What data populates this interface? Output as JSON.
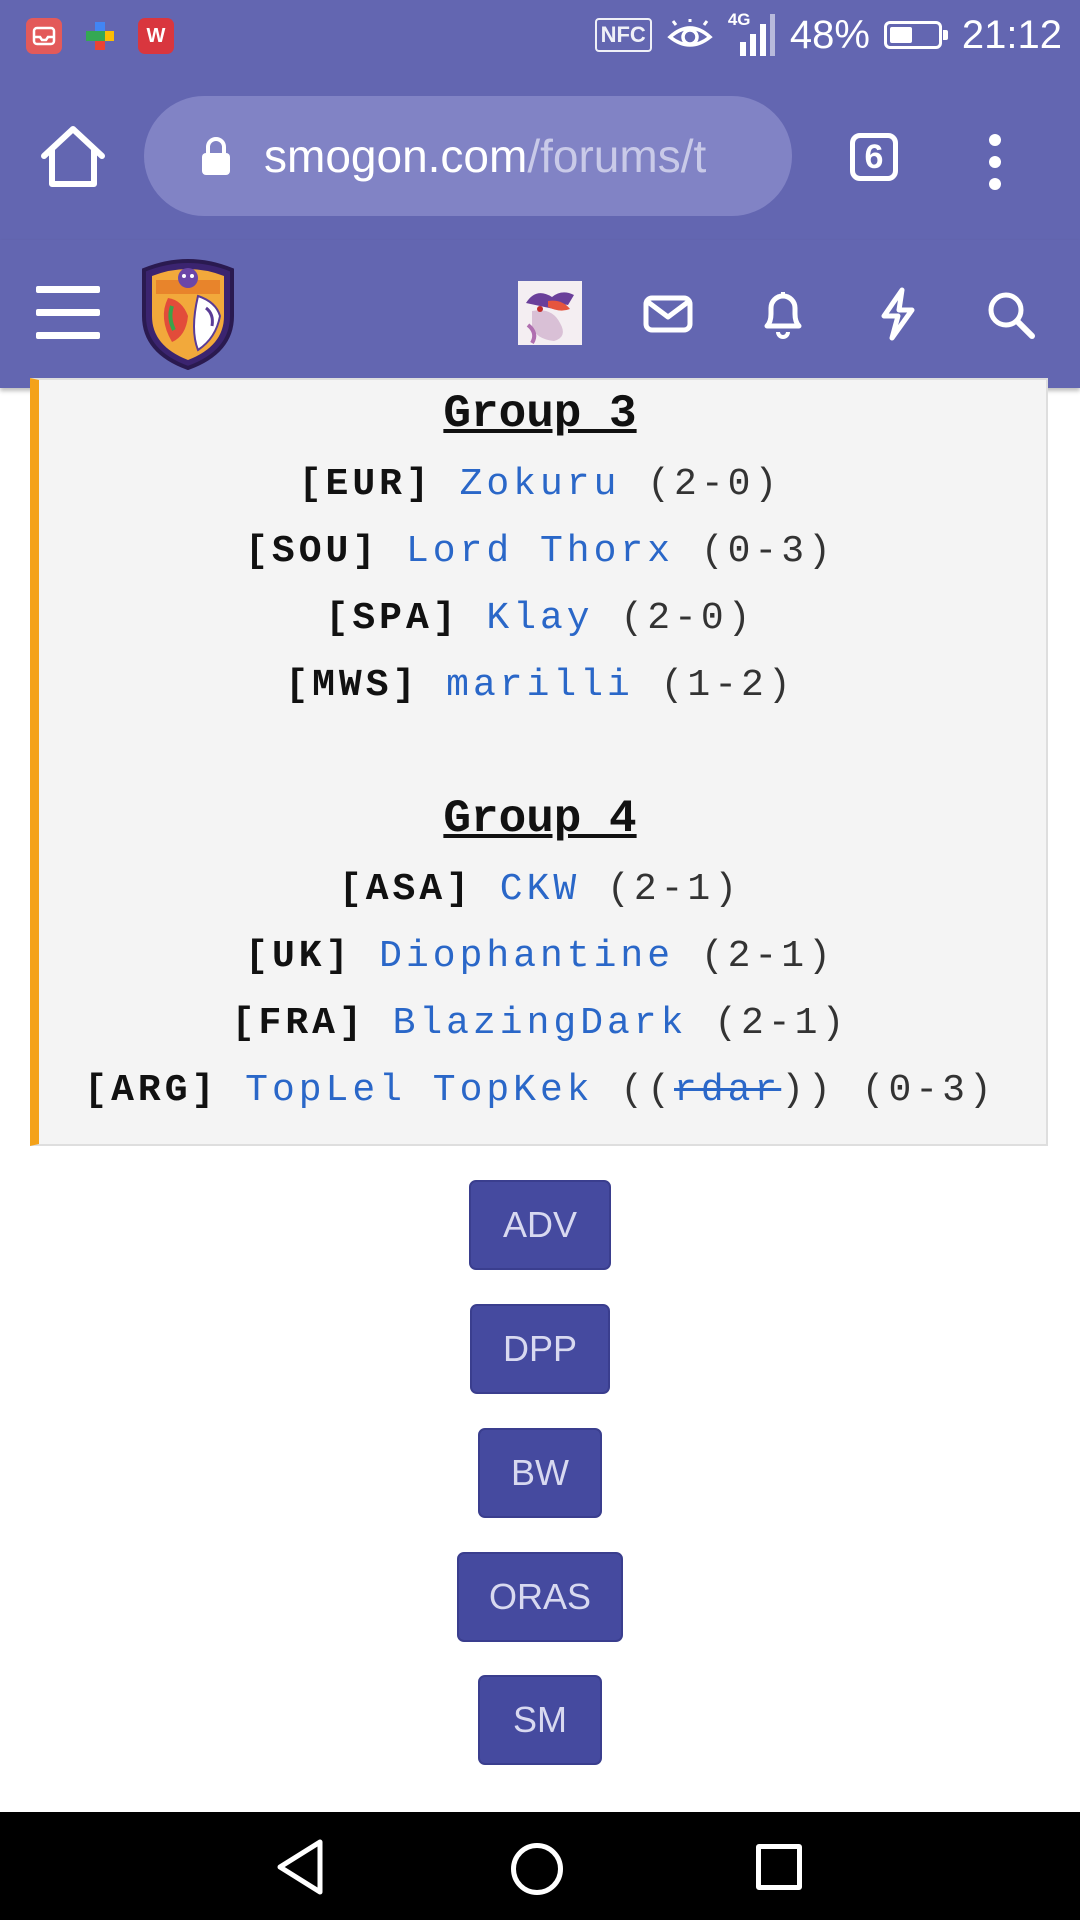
{
  "status_bar": {
    "nfc_label": "NFC",
    "network": "4G",
    "battery_percent_text": "48%",
    "battery_level": 0.48,
    "time": "21:12"
  },
  "browser": {
    "url_host": "smogon.com",
    "url_path": "/forums/t",
    "tab_count": "6"
  },
  "groups": [
    {
      "title": "Group 3",
      "entries": [
        {
          "tag": "[EUR]",
          "name": "Zokuru",
          "record": "(2-0)"
        },
        {
          "tag": "[SOU]",
          "name": "Lord Thorx",
          "record": "(0-3)"
        },
        {
          "tag": "[SPA]",
          "name": "Klay",
          "record": "(2-0)"
        },
        {
          "tag": "[MWS]",
          "name": "marilli",
          "record": "(1-2)"
        }
      ]
    },
    {
      "title": "Group 4",
      "entries": [
        {
          "tag": "[ASA]",
          "name": "CKW",
          "record": "(2-1)"
        },
        {
          "tag": "[UK]",
          "name": "Diophantine",
          "record": "(2-1)"
        },
        {
          "tag": "[FRA]",
          "name": "BlazingDark",
          "record": "(2-1)"
        },
        {
          "tag": "[ARG]",
          "name": "TopLel TopKek",
          "sub_open": "((",
          "sub_struck": "rdar",
          "sub_close": "))",
          "record": "(0-3)"
        }
      ]
    }
  ],
  "tier_buttons": [
    "ADV",
    "DPP",
    "BW",
    "ORAS",
    "SM"
  ],
  "colors": {
    "header": "#6366b1",
    "quote_accent": "#f4a21a",
    "link": "#2a67c8",
    "button": "#454a9f"
  }
}
